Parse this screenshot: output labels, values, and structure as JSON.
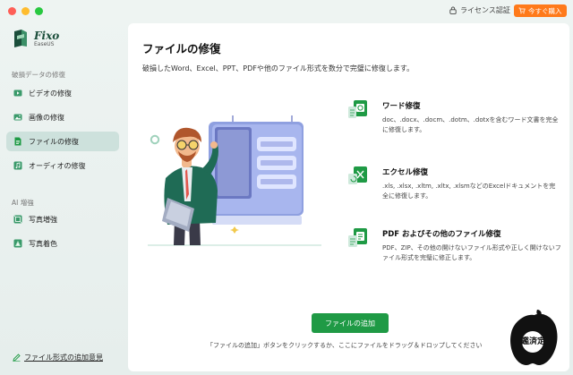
{
  "window": {
    "license_label": "ライセンス認証",
    "buy_label": "今すぐ購入"
  },
  "logo": {
    "name": "Fixo",
    "sub": "EaseUS"
  },
  "sidebar": {
    "section1": "破損データの修復",
    "items1": [
      {
        "label": "ビデオの修復",
        "icon": "video-icon"
      },
      {
        "label": "画像の修復",
        "icon": "image-icon"
      },
      {
        "label": "ファイルの修復",
        "icon": "file-icon",
        "active": true
      },
      {
        "label": "オーディオの修復",
        "icon": "audio-icon"
      }
    ],
    "section2": "AI 増強",
    "items2": [
      {
        "label": "写真増強",
        "icon": "photo-enhance-icon"
      },
      {
        "label": "写真着色",
        "icon": "photo-colorize-icon"
      }
    ],
    "feedback_label": "ファイル形式の追加意見"
  },
  "main": {
    "title": "ファイルの修復",
    "description": "破損したWord、Excel、PPT、PDFや他のファイル形式を数分で完璧に修復します。",
    "features": [
      {
        "title": "ワード修復",
        "text": "doc、.docx、.docm、.dotm、.dotxを含むワード文書を完全に修復します。",
        "icon": "word-repair-icon"
      },
      {
        "title": "エクセル修復",
        "text": ".xls, .xlsx, .xltm, .xltx, .xlsmなどのExcelドキュメントを完全に修復します。",
        "icon": "excel-repair-icon"
      },
      {
        "title": "PDF およびその他のファイル修復",
        "text": "PDF、ZIP、その他の開けないファイル形式や正しく開けないファイル形式を完璧に修正します。",
        "icon": "pdf-repair-icon"
      }
    ],
    "add_button": "ファイルの追加",
    "hint": "「ファイルの追加」ボタンをクリックするか、ここにファイルをドラッグ＆ドロップしてください"
  },
  "watermark": {
    "text": "鑑済定"
  },
  "colors": {
    "accent_green": "#1f9a45",
    "sidebar_active": "#cde1dc",
    "buy_orange": "#ff7a1a"
  }
}
